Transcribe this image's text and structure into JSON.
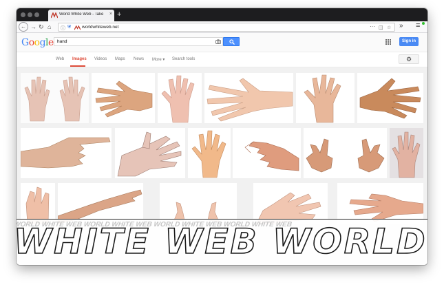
{
  "browser": {
    "tab_title": "World White Web - Take part in",
    "url": "worldwhiteweb.net",
    "new_tab_label": "+",
    "tab_close_label": "×"
  },
  "google": {
    "logo": [
      "G",
      "o",
      "o",
      "g",
      "l",
      "e"
    ],
    "logo_colors": [
      "#4285f4",
      "#ea4335",
      "#fbbc05",
      "#4285f4",
      "#34a853",
      "#ea4335"
    ],
    "query": "hand",
    "signin_label": "Sign in",
    "tabs": [
      "Web",
      "Images",
      "Videos",
      "Maps",
      "News",
      "More ▾",
      "Search tools"
    ],
    "active_tab": "Images",
    "accent": "#dd4b39",
    "button_blue": "#4d90fe"
  },
  "watermark": {
    "big_text": "WHITE WEB WORLD",
    "small_text": "WORLD WHITE WEB WORLD WHITE WEB WORLD WHITE WEB WORLD WHITE WEB"
  },
  "results": {
    "count": 17,
    "subject": "hand"
  }
}
